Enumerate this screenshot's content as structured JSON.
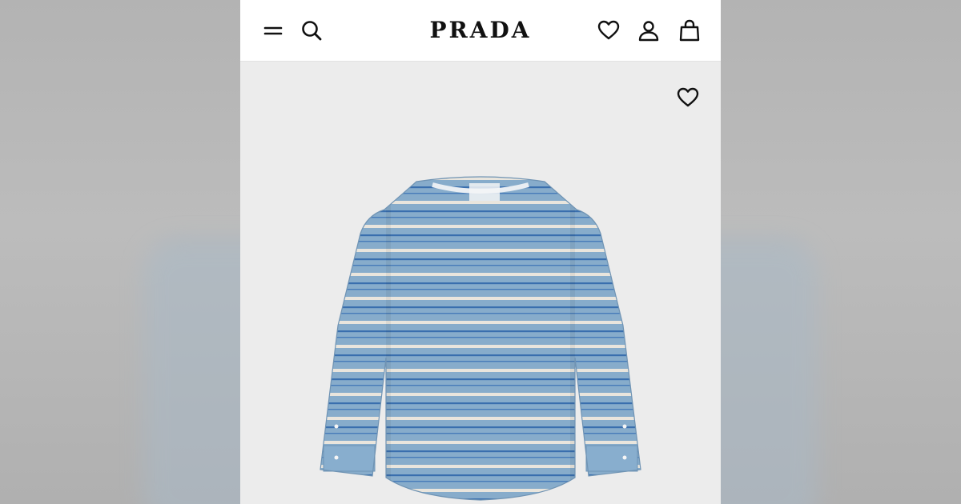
{
  "brand": {
    "logo_text": "PRADA"
  },
  "header": {
    "menu_icon": "menu-icon",
    "search_icon": "search-icon",
    "wishlist_icon": "heart-icon",
    "account_icon": "user-icon",
    "bag_icon": "shopping-bag-icon"
  },
  "product": {
    "image": "striped-shirt",
    "image_description_colors": {
      "base": "#8fb6d6",
      "stripe_white": "#f4f1ea",
      "stripe_blue": "#3f76b8"
    },
    "wishlist_icon": "heart-icon"
  },
  "colors": {
    "header_bg": "#ffffff",
    "page_bg": "#ececec",
    "side_bg": "#b9b9b9",
    "icon": "#111111"
  }
}
